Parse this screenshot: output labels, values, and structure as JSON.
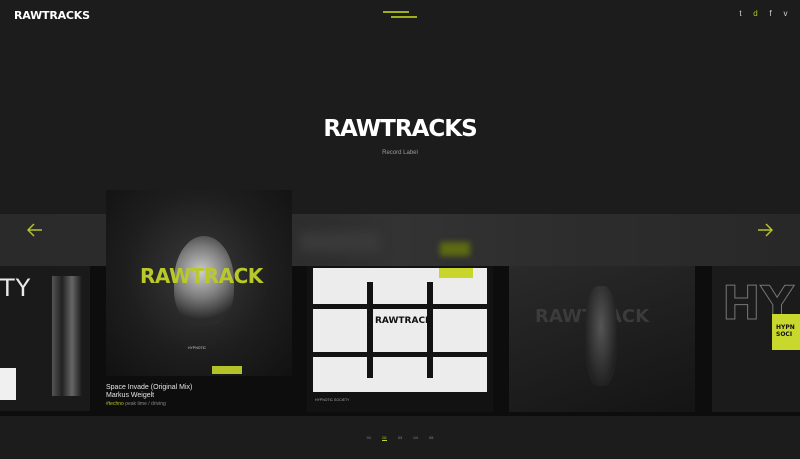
{
  "header": {
    "logo": "RAWTRACKS",
    "social": [
      "t",
      "d",
      "f",
      "v"
    ]
  },
  "hero": {
    "title": "RAWTRACKS",
    "subtitle": "Record Label"
  },
  "nav": {
    "prev": "prev-arrow",
    "next": "next-arrow"
  },
  "covers": {
    "c1_text": "TY",
    "c2_title": "RAWTRACK",
    "c2_society": "HYPNOTIC",
    "c3_label": "RAWTRACK",
    "c3_footer": "HYPNOTIC SOCIETY",
    "c4_text": "RAWTRACK",
    "c5_text": "HY",
    "c5_label": "HYPN SOCI"
  },
  "featured": {
    "title": "Space Invade (Original Mix)",
    "artist": "Markus Weigelt",
    "tag": "#techno",
    "meta": "peak time / driving"
  },
  "pager": [
    "01",
    "02",
    "03",
    "04",
    "05"
  ],
  "colors": {
    "accent": "#b4c22a",
    "background": "#1c1c1c"
  }
}
